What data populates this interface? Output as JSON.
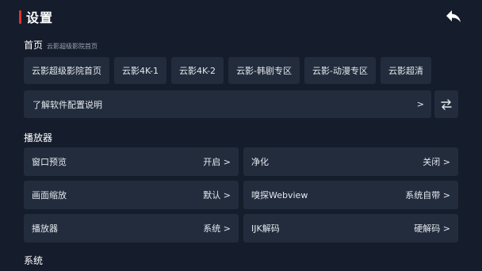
{
  "header": {
    "title": "设置"
  },
  "home": {
    "label": "首页",
    "value": "云影超级影院首页",
    "chips": [
      "云影超级影院首页",
      "云影4K-1",
      "云影4K-2",
      "云影-韩剧专区",
      "云影-动漫专区",
      "云影超清"
    ]
  },
  "about": {
    "label": "了解软件配置说明",
    "chevron": ">"
  },
  "player_section": {
    "title": "播放器",
    "items": [
      {
        "label": "窗口预览",
        "value": "开启 >"
      },
      {
        "label": "净化",
        "value": "关闭 >"
      },
      {
        "label": "画面缩放",
        "value": "默认 >"
      },
      {
        "label": "嗅探Webview",
        "value": "系统自带 >"
      },
      {
        "label": "播放器",
        "value": "系统 >"
      },
      {
        "label": "IJK解码",
        "value": "硬解码 >"
      }
    ]
  },
  "system_section": {
    "title": "系统"
  },
  "icons": {
    "back": "back-arrow-icon",
    "sync": "swap-arrows-icon"
  },
  "colors": {
    "background": "#151d2c",
    "card": "#222c3d",
    "accent": "#e0322f"
  }
}
